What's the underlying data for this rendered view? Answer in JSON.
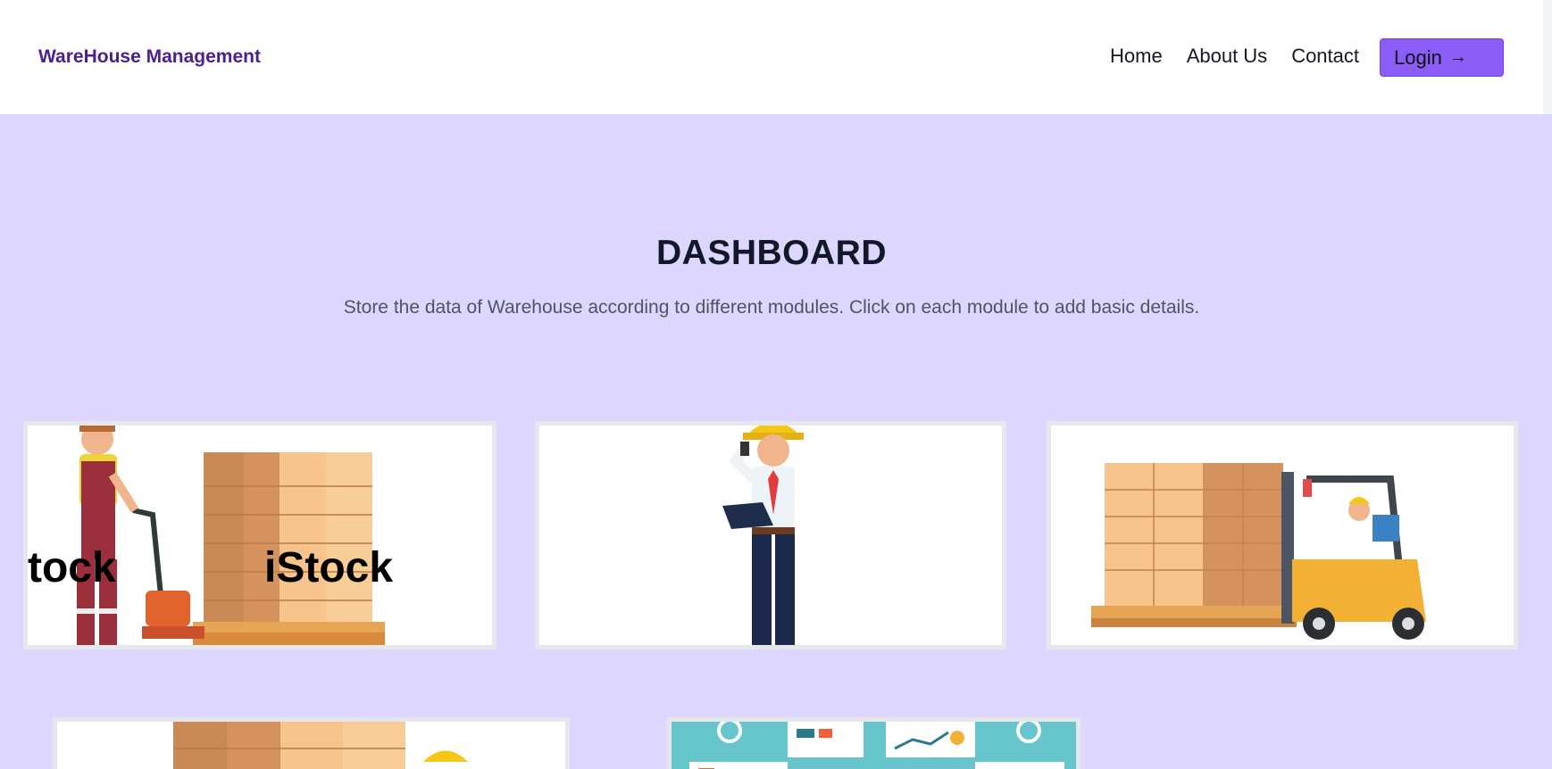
{
  "navbar": {
    "brand": "WareHouse Management",
    "links": [
      "Home",
      "About Us",
      "Contact"
    ],
    "login_label": "Login",
    "login_icon": "arrow-right-icon"
  },
  "hero": {
    "title": "DASHBOARD",
    "subtitle": "Store the data of Warehouse according to different modules. Click on each module to add basic details."
  },
  "cards": {
    "watermark": "iStock",
    "watermark_partial": "tock"
  },
  "colors": {
    "accent": "#8b5cf6",
    "brand": "#4c1d95",
    "background": "#ddd6fe"
  }
}
